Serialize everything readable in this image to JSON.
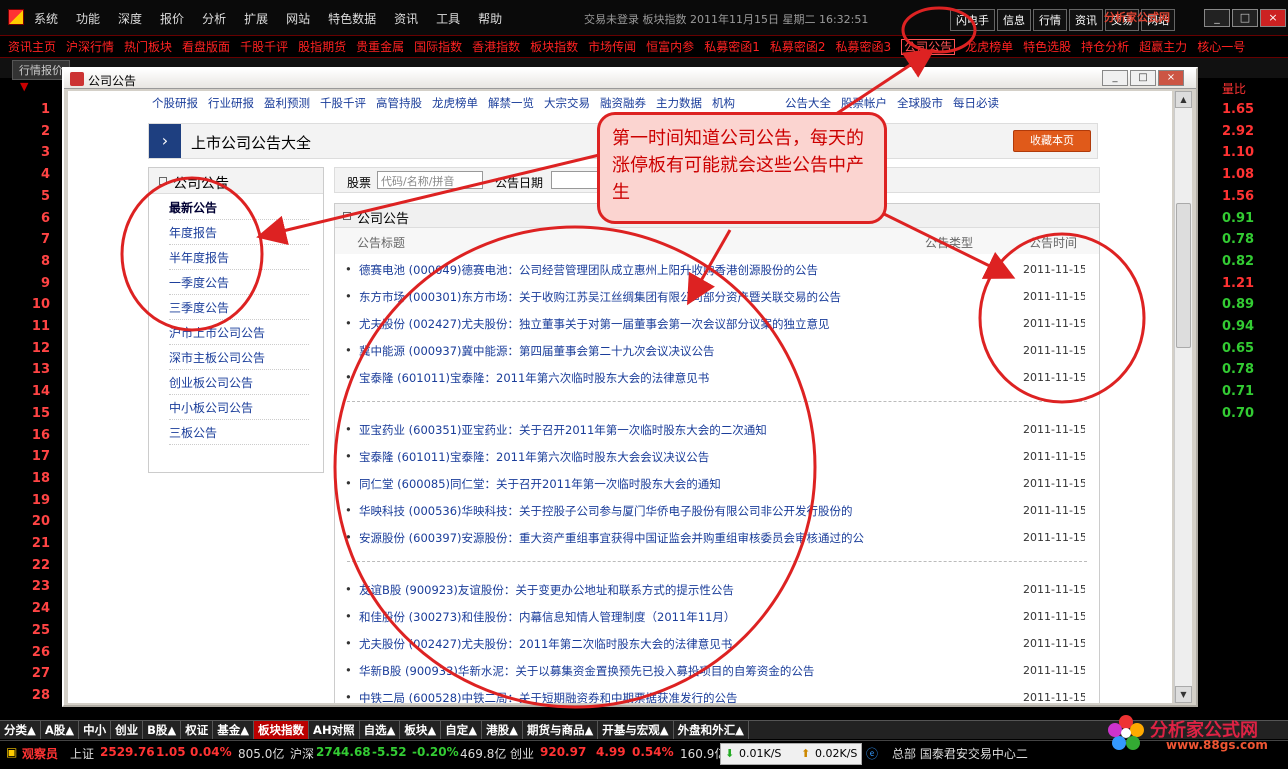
{
  "menubar": {
    "items": [
      "系统",
      "功能",
      "深度",
      "报价",
      "分析",
      "扩展",
      "网站",
      "特色数据",
      "资讯",
      "工具",
      "帮助"
    ],
    "status_title": "交易未登录   板块指数  2011年11月15日  星期二  16:32:51",
    "right_buttons": [
      "闪电手",
      "信息",
      "行情",
      "资讯",
      "交易",
      "网站"
    ],
    "corner_logo": "分析家公式网"
  },
  "quicknav": {
    "items": [
      "资讯主页",
      "沪深行情",
      "热门板块",
      "看盘版面",
      "千股千评",
      "股指期货",
      "贵重金属",
      "国际指数",
      "香港指数",
      "板块指数",
      "市场传闻",
      "恒富内参",
      "私募密函1",
      "私募密函2",
      "私募密函3",
      "公司公告",
      "龙虎榜单",
      "特色选股",
      "持仓分析",
      "超赢主力",
      "核心一号"
    ],
    "active": "公司公告"
  },
  "tabs": {
    "first": "行情报价"
  },
  "index_col": {
    "header": "▼",
    "rows": [
      "1",
      "2",
      "3",
      "4",
      "5",
      "6",
      "7",
      "8",
      "9",
      "10",
      "11",
      "12",
      "13",
      "14",
      "15",
      "16",
      "17",
      "18",
      "19",
      "20",
      "21",
      "22",
      "23",
      "24",
      "25",
      "26",
      "27",
      "28"
    ]
  },
  "ratio_col": {
    "header": "量比",
    "values": [
      {
        "v": "1.65",
        "c": "#ff3333"
      },
      {
        "v": "2.92",
        "c": "#ff3333"
      },
      {
        "v": "1.10",
        "c": "#ff3333"
      },
      {
        "v": "1.08",
        "c": "#ff3333"
      },
      {
        "v": "1.56",
        "c": "#ff3333"
      },
      {
        "v": "0.91",
        "c": "#33cc33"
      },
      {
        "v": "0.78",
        "c": "#33cc33"
      },
      {
        "v": "0.82",
        "c": "#33cc33"
      },
      {
        "v": "1.21",
        "c": "#ff3333"
      },
      {
        "v": "0.89",
        "c": "#33cc33"
      },
      {
        "v": "0.94",
        "c": "#33cc33"
      },
      {
        "v": "0.65",
        "c": "#33cc33"
      },
      {
        "v": "0.78",
        "c": "#33cc33"
      },
      {
        "v": "0.71",
        "c": "#33cc33"
      },
      {
        "v": "0.70",
        "c": "#33cc33"
      }
    ]
  },
  "dialog": {
    "title": "公司公告"
  },
  "web": {
    "nav": [
      "个股研报",
      "行业研报",
      "盈利预测",
      "千股千评",
      "高管持股",
      "龙虎榜单",
      "解禁一览",
      "大宗交易",
      "融资融券",
      "主力数据",
      "机构",
      "",
      "",
      "",
      "",
      "公告大全",
      "股票帐户",
      "全球股市",
      "每日必读"
    ],
    "banner_title": "上市公司公告大全",
    "bookmark": "收藏本页",
    "sidebar_header": "公司公告",
    "sidebar_items": [
      "最新公告",
      "年度报告",
      "半年度报告",
      "一季度公告",
      "三季度公告",
      "沪市上市公司公告",
      "深市主板公司公告",
      "创业板公司公告",
      "中小板公司公告",
      "三板公告"
    ],
    "filter": {
      "stock_label": "股票",
      "stock_placeholder": "代码/名称/拼音",
      "date_label": "公告日期"
    },
    "panel_header": "公司公告",
    "columns": {
      "title": "公告标题",
      "type": "公告类型",
      "time": "公告时间"
    },
    "groups": [
      [
        {
          "t": "德赛电池 (000049)德赛电池：公司经营管理团队成立惠州上阳升收购香港创源股份的公告",
          "d": "2011-11-15"
        },
        {
          "t": "东方市场 (000301)东方市场：关于收购江苏吴江丝绸集团有限公司部分资产暨关联交易的公告",
          "d": "2011-11-15"
        },
        {
          "t": "尤夫股份 (002427)尤夫股份：独立董事关于对第一届董事会第一次会议部分议案的独立意见",
          "d": "2011-11-15"
        },
        {
          "t": "冀中能源 (000937)冀中能源：第四届董事会第二十九次会议决议公告",
          "d": "2011-11-15"
        },
        {
          "t": "宝泰隆 (601011)宝泰隆：2011年第六次临时股东大会的法律意见书",
          "d": "2011-11-15"
        }
      ],
      [
        {
          "t": "亚宝药业 (600351)亚宝药业：关于召开2011年第一次临时股东大会的二次通知",
          "d": "2011-11-15"
        },
        {
          "t": "宝泰隆 (601011)宝泰隆：2011年第六次临时股东大会会议决议公告",
          "d": "2011-11-15"
        },
        {
          "t": "同仁堂 (600085)同仁堂：关于召开2011年第一次临时股东大会的通知",
          "d": "2011-11-15"
        },
        {
          "t": "华映科技 (000536)华映科技：关于控股子公司参与厦门华侨电子股份有限公司非公开发行股份的",
          "d": "2011-11-15"
        },
        {
          "t": "安源股份 (600397)安源股份：重大资产重组事宜获得中国证监会并购重组审核委员会审核通过的公",
          "d": "2011-11-15"
        }
      ],
      [
        {
          "t": "友谊B股 (900923)友谊股份：关于变更办公地址和联系方式的提示性公告",
          "d": "2011-11-15"
        },
        {
          "t": "和佳股份 (300273)和佳股份：内幕信息知情人管理制度（2011年11月）",
          "d": "2011-11-15"
        },
        {
          "t": "尤夫股份 (002427)尤夫股份：2011年第二次临时股东大会的法律意见书",
          "d": "2011-11-15"
        },
        {
          "t": "华新B股 (900933)华新水泥：关于以募集资金置换预先已投入募投项目的自筹资金的公告",
          "d": "2011-11-15"
        },
        {
          "t": "中铁二局 (600528)中铁二局：关于短期融资券和中期票据获准发行的公告",
          "d": "2011-11-15"
        }
      ]
    ]
  },
  "callout": {
    "text": "第一时间知道公司公告，每天的涨停板有可能就会这些公告中产生"
  },
  "bottom_tabs": {
    "items": [
      "分类▲",
      "A股▲",
      "中小",
      "创业",
      "B股▲",
      "权证",
      "基金▲",
      "板块指数",
      "AH对照",
      "自选▲",
      "板块▲",
      "自定▲",
      "港股▲",
      "期货与商品▲",
      "开基与宏观▲",
      "外盘和外汇▲"
    ],
    "active": "板块指数"
  },
  "statusbar": {
    "user": "观察员",
    "sh": {
      "name": "上证",
      "price": "2529.76",
      "chg": "1.05",
      "pct": "0.04%",
      "vol": "805.0亿"
    },
    "sz": {
      "name": "沪深",
      "price": "2744.68",
      "chg": "-5.52",
      "pct": "-0.20%",
      "vol": "469.8亿"
    },
    "cy": {
      "name": "创业",
      "price": "920.97",
      "chg": "4.99",
      "pct": "0.54%",
      "vol": "160.9亿"
    },
    "down_speed": "0.01K/S",
    "up_speed": "0.02K/S",
    "broker": "总部  国泰君安交易中心二"
  },
  "brand": {
    "name": "分析家公式网",
    "url": "www.88gs.com"
  },
  "colors": {
    "accent": "#ff2222",
    "link": "#1a3d9a",
    "annotation": "#dd2222"
  }
}
